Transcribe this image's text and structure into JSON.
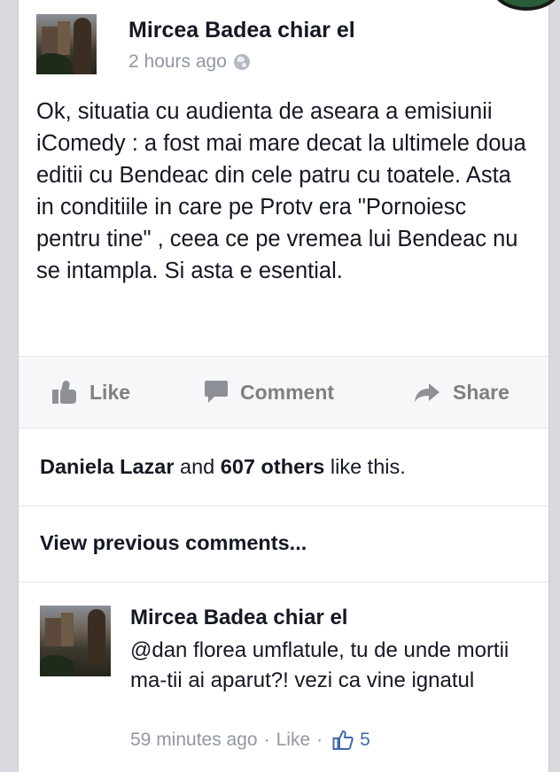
{
  "post": {
    "author": "Mircea Badea chiar el",
    "time": "2 hours ago",
    "privacy_icon": "globe-icon",
    "text": "Ok, situatia cu audienta de aseara a emisiunii iComedy : a fost mai mare decat la ultimele doua editii cu Bendeac din cele patru cu toatele. Asta in conditiile in care pe Protv era \"Pornoiesc pentru tine\" , ceea ce pe vremea lui Bendeac nu se intampla. Si asta e esential."
  },
  "actions": {
    "like_label": "Like",
    "comment_label": "Comment",
    "share_label": "Share"
  },
  "likes_summary": {
    "first_name": "Daniela Lazar",
    "and_text": "and",
    "others_count": "607 others",
    "suffix": "like this."
  },
  "view_previous_label": "View previous comments...",
  "comment": {
    "author": "Mircea Badea chiar el",
    "text": "@dan florea umflatule, tu de unde mortii ma-tii ai aparut?! vezi ca vine ignatul",
    "time": "59 minutes ago",
    "separator": "·",
    "like_label": "Like",
    "like_count": "5"
  },
  "colors": {
    "text": "#141823",
    "meta": "#9197a3",
    "action": "#7f7f7f",
    "link_blue": "#4267b2"
  }
}
